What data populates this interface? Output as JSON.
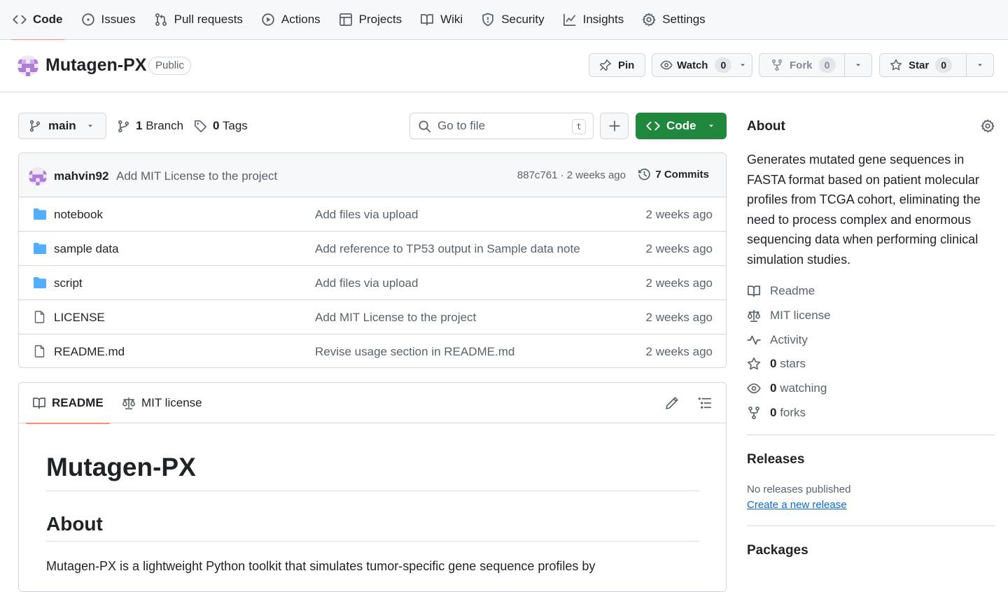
{
  "nav": {
    "tabs": [
      {
        "label": "Code",
        "icon": "code-icon",
        "active": true
      },
      {
        "label": "Issues",
        "icon": "issue-icon"
      },
      {
        "label": "Pull requests",
        "icon": "pull-request-icon"
      },
      {
        "label": "Actions",
        "icon": "play-icon"
      },
      {
        "label": "Projects",
        "icon": "table-icon"
      },
      {
        "label": "Wiki",
        "icon": "book-icon"
      },
      {
        "label": "Security",
        "icon": "shield-icon"
      },
      {
        "label": "Insights",
        "icon": "graph-icon"
      },
      {
        "label": "Settings",
        "icon": "gear-icon"
      }
    ]
  },
  "repo": {
    "name": "Mutagen-PX",
    "visibility": "Public",
    "pin_label": "Pin",
    "watch_label": "Watch",
    "watch_count": "0",
    "fork_label": "Fork",
    "fork_count": "0",
    "star_label": "Star",
    "star_count": "0"
  },
  "toolbar": {
    "branch": "main",
    "branch_count": "1",
    "branch_label": "Branch",
    "tag_count": "0",
    "tag_label": "Tags",
    "goto_placeholder": "Go to file",
    "goto_shortcut": "t",
    "code_label": "Code"
  },
  "latest_commit": {
    "author": "mahvin92",
    "message": "Add MIT License to the project",
    "hash_time": "887c761 · 2 weeks ago",
    "commits_label": "7 Commits"
  },
  "files": [
    {
      "name": "notebook",
      "type": "folder",
      "message": "Add files via upload",
      "date": "2 weeks ago"
    },
    {
      "name": "sample data",
      "type": "folder",
      "message": "Add reference to TP53 output in Sample data note",
      "date": "2 weeks ago"
    },
    {
      "name": "script",
      "type": "folder",
      "message": "Add files via upload",
      "date": "2 weeks ago"
    },
    {
      "name": "LICENSE",
      "type": "file",
      "message": "Add MIT License to the project",
      "date": "2 weeks ago"
    },
    {
      "name": "README.md",
      "type": "file",
      "message": "Revise usage section in README.md",
      "date": "2 weeks ago"
    }
  ],
  "readme": {
    "tab_readme": "README",
    "tab_license": "MIT license",
    "h1": "Mutagen-PX",
    "h2": "About",
    "paragraph": "Mutagen-PX is a lightweight Python toolkit that simulates tumor-specific gene sequence profiles by"
  },
  "about": {
    "title": "About",
    "description": "Generates mutated gene sequences in FASTA format based on patient molecular profiles from TCGA cohort, eliminating the need to process complex and enormous sequencing data when performing clinical simulation studies.",
    "links": [
      {
        "label": "Readme",
        "icon": "book-icon"
      },
      {
        "label": "MIT license",
        "icon": "law-icon"
      },
      {
        "label": "Activity",
        "icon": "pulse-icon"
      }
    ],
    "stats": [
      {
        "count": "0",
        "label": "stars",
        "icon": "star-icon"
      },
      {
        "count": "0",
        "label": "watching",
        "icon": "eye-icon"
      },
      {
        "count": "0",
        "label": "forks",
        "icon": "fork-icon"
      }
    ]
  },
  "releases": {
    "title": "Releases",
    "note": "No releases published",
    "link": "Create a new release"
  },
  "packages": {
    "title": "Packages"
  },
  "colors": {
    "accent_underline": "#fd8c73",
    "code_button": "#1f883d",
    "link": "#0969da",
    "folder": "#54aeff"
  }
}
